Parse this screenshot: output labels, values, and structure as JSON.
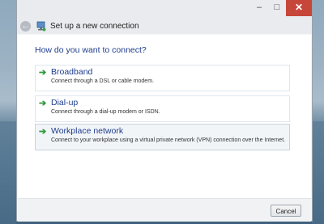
{
  "window": {
    "title": "Set up a new connection",
    "controls": {
      "minimize": "–",
      "maximize": "□",
      "close": "✕"
    },
    "back_icon": "back-arrow-icon",
    "app_icon": "network-connection-icon"
  },
  "main": {
    "heading": "How do you want to connect?",
    "options": [
      {
        "name": "Broadband",
        "description": "Connect through a DSL or cable modem."
      },
      {
        "name": "Dial-up",
        "description": "Connect through a dial-up modem or ISDN."
      },
      {
        "name": "Workplace network",
        "description": "Connect to your workplace using a virtual private network (VPN) connection over the Internet."
      }
    ],
    "option_arrow": "➔"
  },
  "footer": {
    "cancel_label": "Cancel"
  },
  "colors": {
    "accent": "#1e3c8c",
    "arrow": "#2d9a3c",
    "close": "#c7463a"
  }
}
